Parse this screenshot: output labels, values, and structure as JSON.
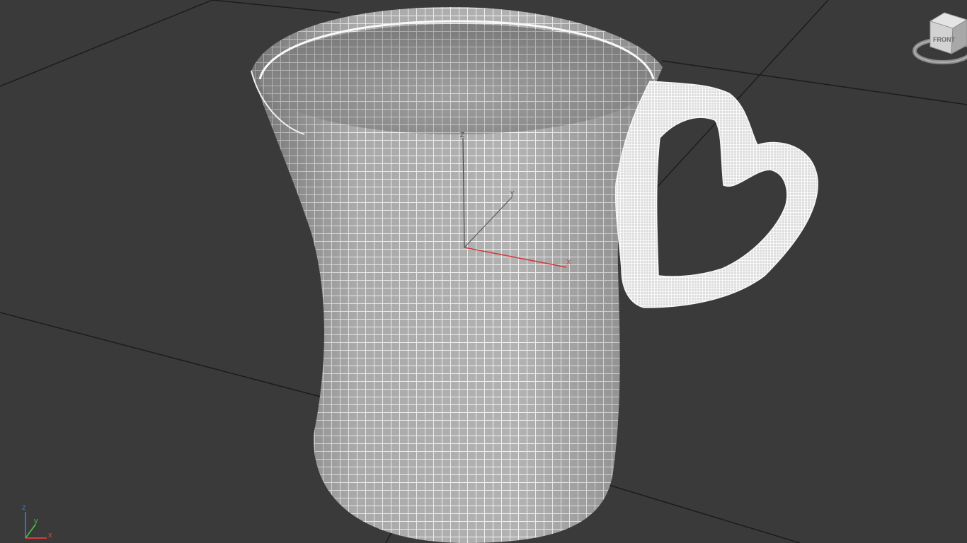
{
  "viewport": {
    "background": "#3a3a3a",
    "grid_color": "#1c1c1c",
    "mesh_color": "#f2f2f2",
    "shade_color": "#9a9a9a"
  },
  "viewcube": {
    "face_label": "FRONT"
  },
  "pivot_gizmo": {
    "x_label": "X",
    "y_label": "Y",
    "z_label": "Z",
    "x_color": "#d23a3a",
    "y_color": "#5a5a5a",
    "z_color": "#4a4a4a"
  },
  "corner_axis": {
    "x_label": "x",
    "y_label": "y",
    "z_label": "z",
    "x_color": "#e04040",
    "y_color": "#3fbf3f",
    "z_color": "#3f6fe0"
  }
}
